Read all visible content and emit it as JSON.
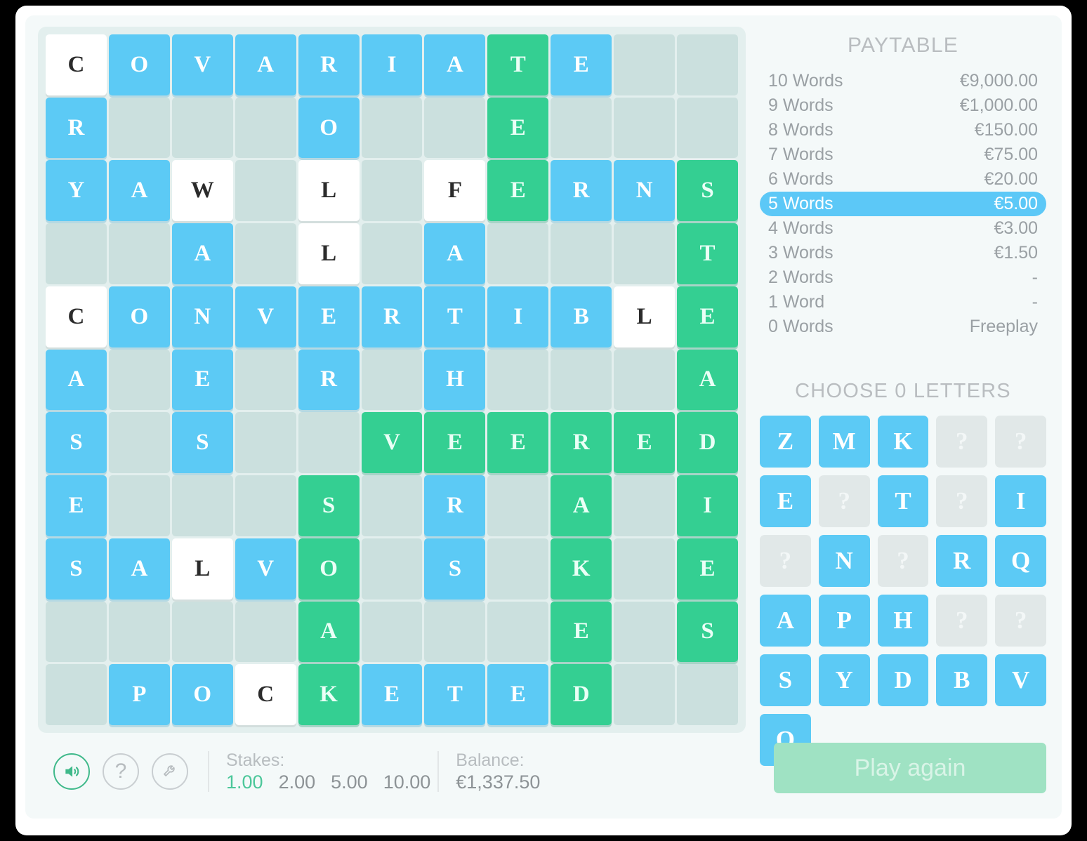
{
  "board": {
    "rows": 11,
    "cols": 11,
    "colors": {
      "blue": "#5ccaf5",
      "green": "#34cf92",
      "white": "#ffffff",
      "empty": "#cbe0de"
    },
    "grid": [
      [
        {
          "l": "C",
          "s": "white"
        },
        {
          "l": "O",
          "s": "blue"
        },
        {
          "l": "V",
          "s": "blue"
        },
        {
          "l": "A",
          "s": "blue"
        },
        {
          "l": "R",
          "s": "blue"
        },
        {
          "l": "I",
          "s": "blue"
        },
        {
          "l": "A",
          "s": "blue"
        },
        {
          "l": "T",
          "s": "green"
        },
        {
          "l": "E",
          "s": "blue"
        },
        {
          "l": "",
          "s": "empty"
        },
        {
          "l": "",
          "s": "empty"
        }
      ],
      [
        {
          "l": "R",
          "s": "blue"
        },
        {
          "l": "",
          "s": "empty"
        },
        {
          "l": "",
          "s": "empty"
        },
        {
          "l": "",
          "s": "empty"
        },
        {
          "l": "O",
          "s": "blue"
        },
        {
          "l": "",
          "s": "empty"
        },
        {
          "l": "",
          "s": "empty"
        },
        {
          "l": "E",
          "s": "green"
        },
        {
          "l": "",
          "s": "empty"
        },
        {
          "l": "",
          "s": "empty"
        },
        {
          "l": "",
          "s": "empty"
        }
      ],
      [
        {
          "l": "Y",
          "s": "blue"
        },
        {
          "l": "A",
          "s": "blue"
        },
        {
          "l": "W",
          "s": "white"
        },
        {
          "l": "",
          "s": "empty"
        },
        {
          "l": "L",
          "s": "white"
        },
        {
          "l": "",
          "s": "empty"
        },
        {
          "l": "F",
          "s": "white"
        },
        {
          "l": "E",
          "s": "green"
        },
        {
          "l": "R",
          "s": "blue"
        },
        {
          "l": "N",
          "s": "blue"
        },
        {
          "l": "S",
          "s": "green"
        }
      ],
      [
        {
          "l": "",
          "s": "empty"
        },
        {
          "l": "",
          "s": "empty"
        },
        {
          "l": "A",
          "s": "blue"
        },
        {
          "l": "",
          "s": "empty"
        },
        {
          "l": "L",
          "s": "white"
        },
        {
          "l": "",
          "s": "empty"
        },
        {
          "l": "A",
          "s": "blue"
        },
        {
          "l": "",
          "s": "empty"
        },
        {
          "l": "",
          "s": "empty"
        },
        {
          "l": "",
          "s": "empty"
        },
        {
          "l": "T",
          "s": "green"
        }
      ],
      [
        {
          "l": "C",
          "s": "white"
        },
        {
          "l": "O",
          "s": "blue"
        },
        {
          "l": "N",
          "s": "blue"
        },
        {
          "l": "V",
          "s": "blue"
        },
        {
          "l": "E",
          "s": "blue"
        },
        {
          "l": "R",
          "s": "blue"
        },
        {
          "l": "T",
          "s": "blue"
        },
        {
          "l": "I",
          "s": "blue"
        },
        {
          "l": "B",
          "s": "blue"
        },
        {
          "l": "L",
          "s": "white"
        },
        {
          "l": "E",
          "s": "green"
        }
      ],
      [
        {
          "l": "A",
          "s": "blue"
        },
        {
          "l": "",
          "s": "empty"
        },
        {
          "l": "E",
          "s": "blue"
        },
        {
          "l": "",
          "s": "empty"
        },
        {
          "l": "R",
          "s": "blue"
        },
        {
          "l": "",
          "s": "empty"
        },
        {
          "l": "H",
          "s": "blue"
        },
        {
          "l": "",
          "s": "empty"
        },
        {
          "l": "",
          "s": "empty"
        },
        {
          "l": "",
          "s": "empty"
        },
        {
          "l": "A",
          "s": "green"
        }
      ],
      [
        {
          "l": "S",
          "s": "blue"
        },
        {
          "l": "",
          "s": "empty"
        },
        {
          "l": "S",
          "s": "blue"
        },
        {
          "l": "",
          "s": "empty"
        },
        {
          "l": "",
          "s": "empty"
        },
        {
          "l": "V",
          "s": "green"
        },
        {
          "l": "E",
          "s": "green"
        },
        {
          "l": "E",
          "s": "green"
        },
        {
          "l": "R",
          "s": "green"
        },
        {
          "l": "E",
          "s": "green"
        },
        {
          "l": "D",
          "s": "green"
        }
      ],
      [
        {
          "l": "E",
          "s": "blue"
        },
        {
          "l": "",
          "s": "empty"
        },
        {
          "l": "",
          "s": "empty"
        },
        {
          "l": "",
          "s": "empty"
        },
        {
          "l": "S",
          "s": "green"
        },
        {
          "l": "",
          "s": "empty"
        },
        {
          "l": "R",
          "s": "blue"
        },
        {
          "l": "",
          "s": "empty"
        },
        {
          "l": "A",
          "s": "green"
        },
        {
          "l": "",
          "s": "empty"
        },
        {
          "l": "I",
          "s": "green"
        }
      ],
      [
        {
          "l": "S",
          "s": "blue"
        },
        {
          "l": "A",
          "s": "blue"
        },
        {
          "l": "L",
          "s": "white"
        },
        {
          "l": "V",
          "s": "blue"
        },
        {
          "l": "O",
          "s": "green"
        },
        {
          "l": "",
          "s": "empty"
        },
        {
          "l": "S",
          "s": "blue"
        },
        {
          "l": "",
          "s": "empty"
        },
        {
          "l": "K",
          "s": "green"
        },
        {
          "l": "",
          "s": "empty"
        },
        {
          "l": "E",
          "s": "green"
        }
      ],
      [
        {
          "l": "",
          "s": "empty"
        },
        {
          "l": "",
          "s": "empty"
        },
        {
          "l": "",
          "s": "empty"
        },
        {
          "l": "",
          "s": "empty"
        },
        {
          "l": "A",
          "s": "green"
        },
        {
          "l": "",
          "s": "empty"
        },
        {
          "l": "",
          "s": "empty"
        },
        {
          "l": "",
          "s": "empty"
        },
        {
          "l": "E",
          "s": "green"
        },
        {
          "l": "",
          "s": "empty"
        },
        {
          "l": "S",
          "s": "green"
        }
      ],
      [
        {
          "l": "",
          "s": "empty"
        },
        {
          "l": "P",
          "s": "blue"
        },
        {
          "l": "O",
          "s": "blue"
        },
        {
          "l": "C",
          "s": "white"
        },
        {
          "l": "K",
          "s": "green"
        },
        {
          "l": "E",
          "s": "blue"
        },
        {
          "l": "T",
          "s": "blue"
        },
        {
          "l": "E",
          "s": "blue"
        },
        {
          "l": "D",
          "s": "green"
        },
        {
          "l": "",
          "s": "empty"
        },
        {
          "l": "",
          "s": "empty"
        }
      ]
    ]
  },
  "paytable": {
    "title": "PAYTABLE",
    "highlight_color": "#5cc8f7",
    "rows": [
      {
        "label": "10 Words",
        "value": "€9,000.00",
        "selected": false
      },
      {
        "label": "9 Words",
        "value": "€1,000.00",
        "selected": false
      },
      {
        "label": "8 Words",
        "value": "€150.00",
        "selected": false
      },
      {
        "label": "7 Words",
        "value": "€75.00",
        "selected": false
      },
      {
        "label": "6 Words",
        "value": "€20.00",
        "selected": false
      },
      {
        "label": "5 Words",
        "value": "€5.00",
        "selected": true
      },
      {
        "label": "4 Words",
        "value": "€3.00",
        "selected": false
      },
      {
        "label": "3 Words",
        "value": "€1.50",
        "selected": false
      },
      {
        "label": "2 Words",
        "value": "-",
        "selected": false
      },
      {
        "label": "1 Word",
        "value": "-",
        "selected": false
      },
      {
        "label": "0 Words",
        "value": "Freeplay",
        "selected": false
      }
    ]
  },
  "chooser": {
    "title": "CHOOSE 0 LETTERS",
    "tiles": [
      {
        "label": "Z",
        "state": "active"
      },
      {
        "label": "M",
        "state": "active"
      },
      {
        "label": "K",
        "state": "active"
      },
      {
        "label": "?",
        "state": "unknown"
      },
      {
        "label": "?",
        "state": "unknown"
      },
      {
        "label": "E",
        "state": "active"
      },
      {
        "label": "?",
        "state": "unknown"
      },
      {
        "label": "T",
        "state": "active"
      },
      {
        "label": "?",
        "state": "unknown"
      },
      {
        "label": "I",
        "state": "active"
      },
      {
        "label": "?",
        "state": "unknown"
      },
      {
        "label": "N",
        "state": "active"
      },
      {
        "label": "?",
        "state": "unknown"
      },
      {
        "label": "R",
        "state": "active"
      },
      {
        "label": "Q",
        "state": "active"
      },
      {
        "label": "A",
        "state": "active"
      },
      {
        "label": "P",
        "state": "active"
      },
      {
        "label": "H",
        "state": "active"
      },
      {
        "label": "?",
        "state": "unknown"
      },
      {
        "label": "?",
        "state": "unknown"
      },
      {
        "label": "S",
        "state": "active"
      },
      {
        "label": "Y",
        "state": "active"
      },
      {
        "label": "D",
        "state": "active"
      },
      {
        "label": "B",
        "state": "active"
      },
      {
        "label": "V",
        "state": "active"
      },
      {
        "label": "O",
        "state": "active"
      }
    ]
  },
  "footer": {
    "icons": [
      {
        "name": "sound-icon",
        "glyph": "sound"
      },
      {
        "name": "help-icon",
        "glyph": "question"
      },
      {
        "name": "settings-icon",
        "glyph": "wrench"
      }
    ],
    "stakes_label": "Stakes:",
    "stakes": [
      {
        "value": "1.00",
        "active": true
      },
      {
        "value": "2.00",
        "active": false
      },
      {
        "value": "5.00",
        "active": false
      },
      {
        "value": "10.00",
        "active": false
      }
    ],
    "balance_label": "Balance:",
    "balance_value": "€1,337.50",
    "play_again_label": "Play again"
  }
}
